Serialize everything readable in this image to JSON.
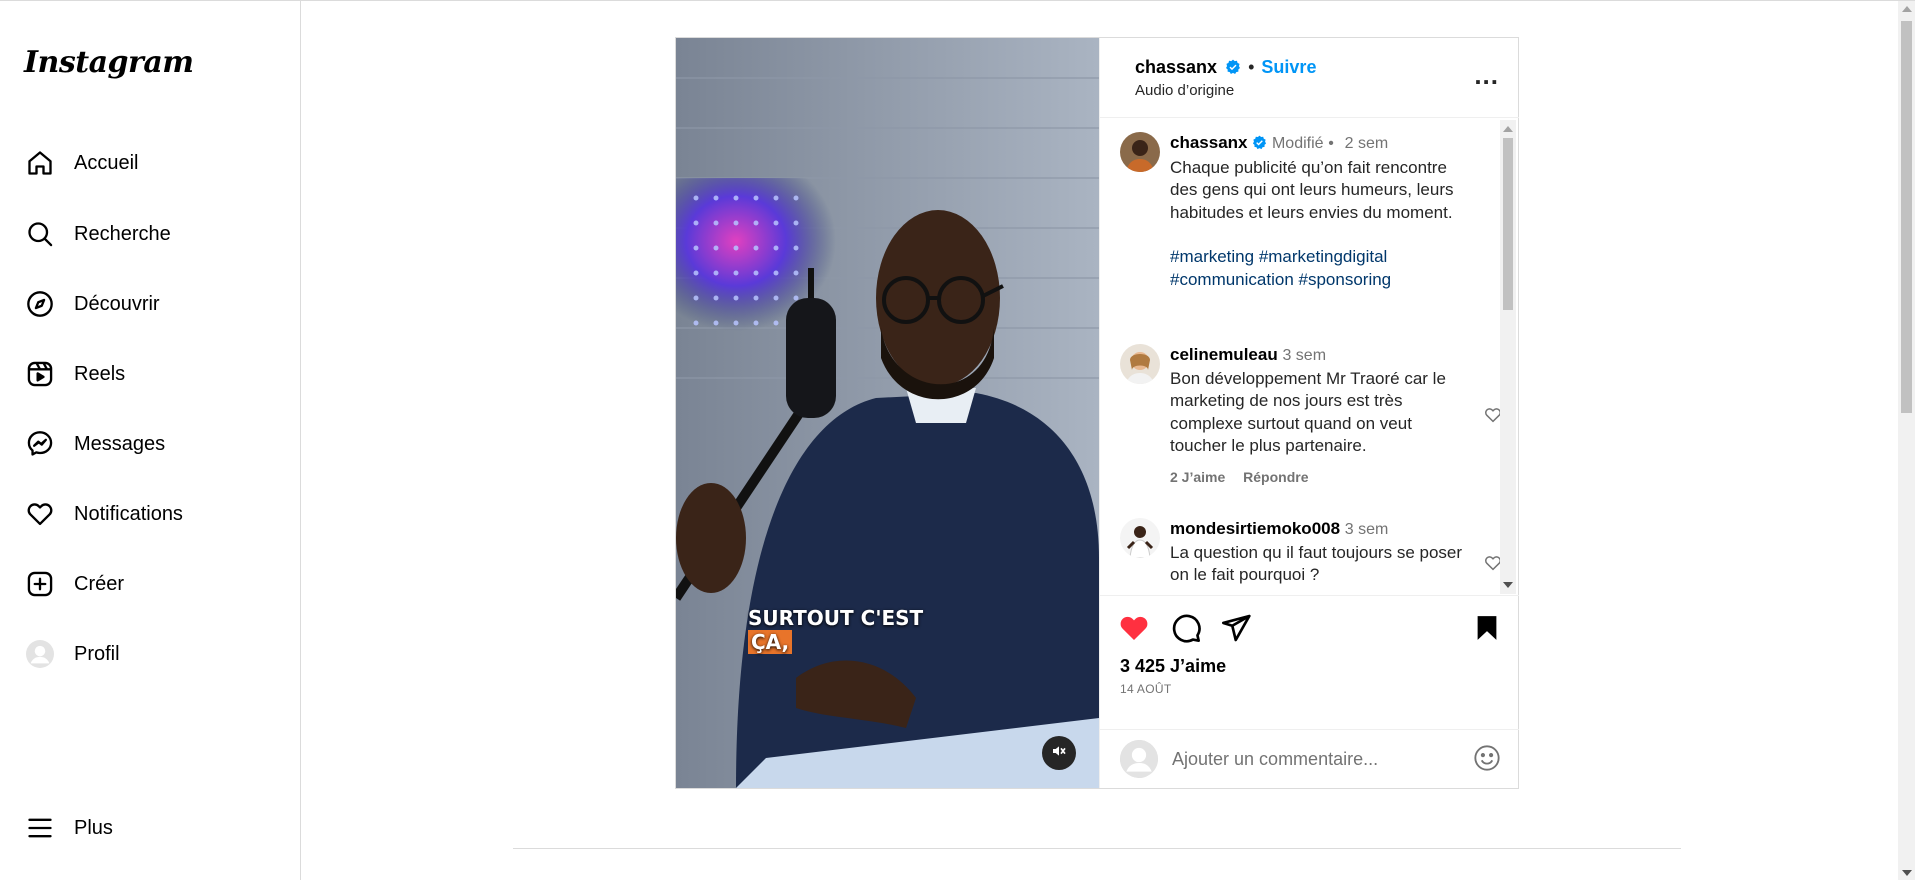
{
  "sidebar": {
    "logo": "Instagram",
    "items": [
      {
        "label": "Accueil",
        "icon": "home-icon"
      },
      {
        "label": "Recherche",
        "icon": "search-icon"
      },
      {
        "label": "Découvrir",
        "icon": "compass-icon"
      },
      {
        "label": "Reels",
        "icon": "reels-icon"
      },
      {
        "label": "Messages",
        "icon": "messenger-icon"
      },
      {
        "label": "Notifications",
        "icon": "heart-icon"
      },
      {
        "label": "Créer",
        "icon": "plus-square-icon"
      },
      {
        "label": "Profil",
        "icon": "avatar-icon"
      }
    ],
    "more_label": "Plus"
  },
  "post": {
    "header": {
      "username": "chassanx",
      "dot": "•",
      "follow": "Suivre",
      "audio": "Audio d’origine",
      "more": "..."
    },
    "media": {
      "caption_line1": "SURTOUT C'EST",
      "caption_line2": "ÇA,"
    },
    "caption": {
      "username": "chassanx",
      "edited": "Modifié",
      "dot": "•",
      "time": "2 sem",
      "text": "Chaque publicité qu’on fait rencontre des gens qui ont leurs humeurs, leurs habitudes et leurs envies du moment.",
      "tags_line1": "#marketing #marketingdigital",
      "tags_line2": "#communication #sponsoring"
    },
    "comments": [
      {
        "username": "celinemuleau",
        "time": "3 sem",
        "text": "Bon développement Mr Traoré car le marketing de nos jours est très complexe surtout quand on veut toucher le plus partenaire.",
        "likes": "2 J’aime",
        "reply": "Répondre"
      },
      {
        "username": "mondesirtiemoko008",
        "time": "3 sem",
        "text": "La question qu il faut toujours se poser on le fait pourquoi ?"
      }
    ],
    "likes": "3 425 J’aime",
    "date": "14 AOÛT",
    "comment_placeholder": "Ajouter un commentaire..."
  },
  "colors": {
    "accent": "#0095f6",
    "verified": "#0095f6",
    "like_red": "#ff3040",
    "hashtag": "#00376b",
    "muted": "#737373"
  }
}
